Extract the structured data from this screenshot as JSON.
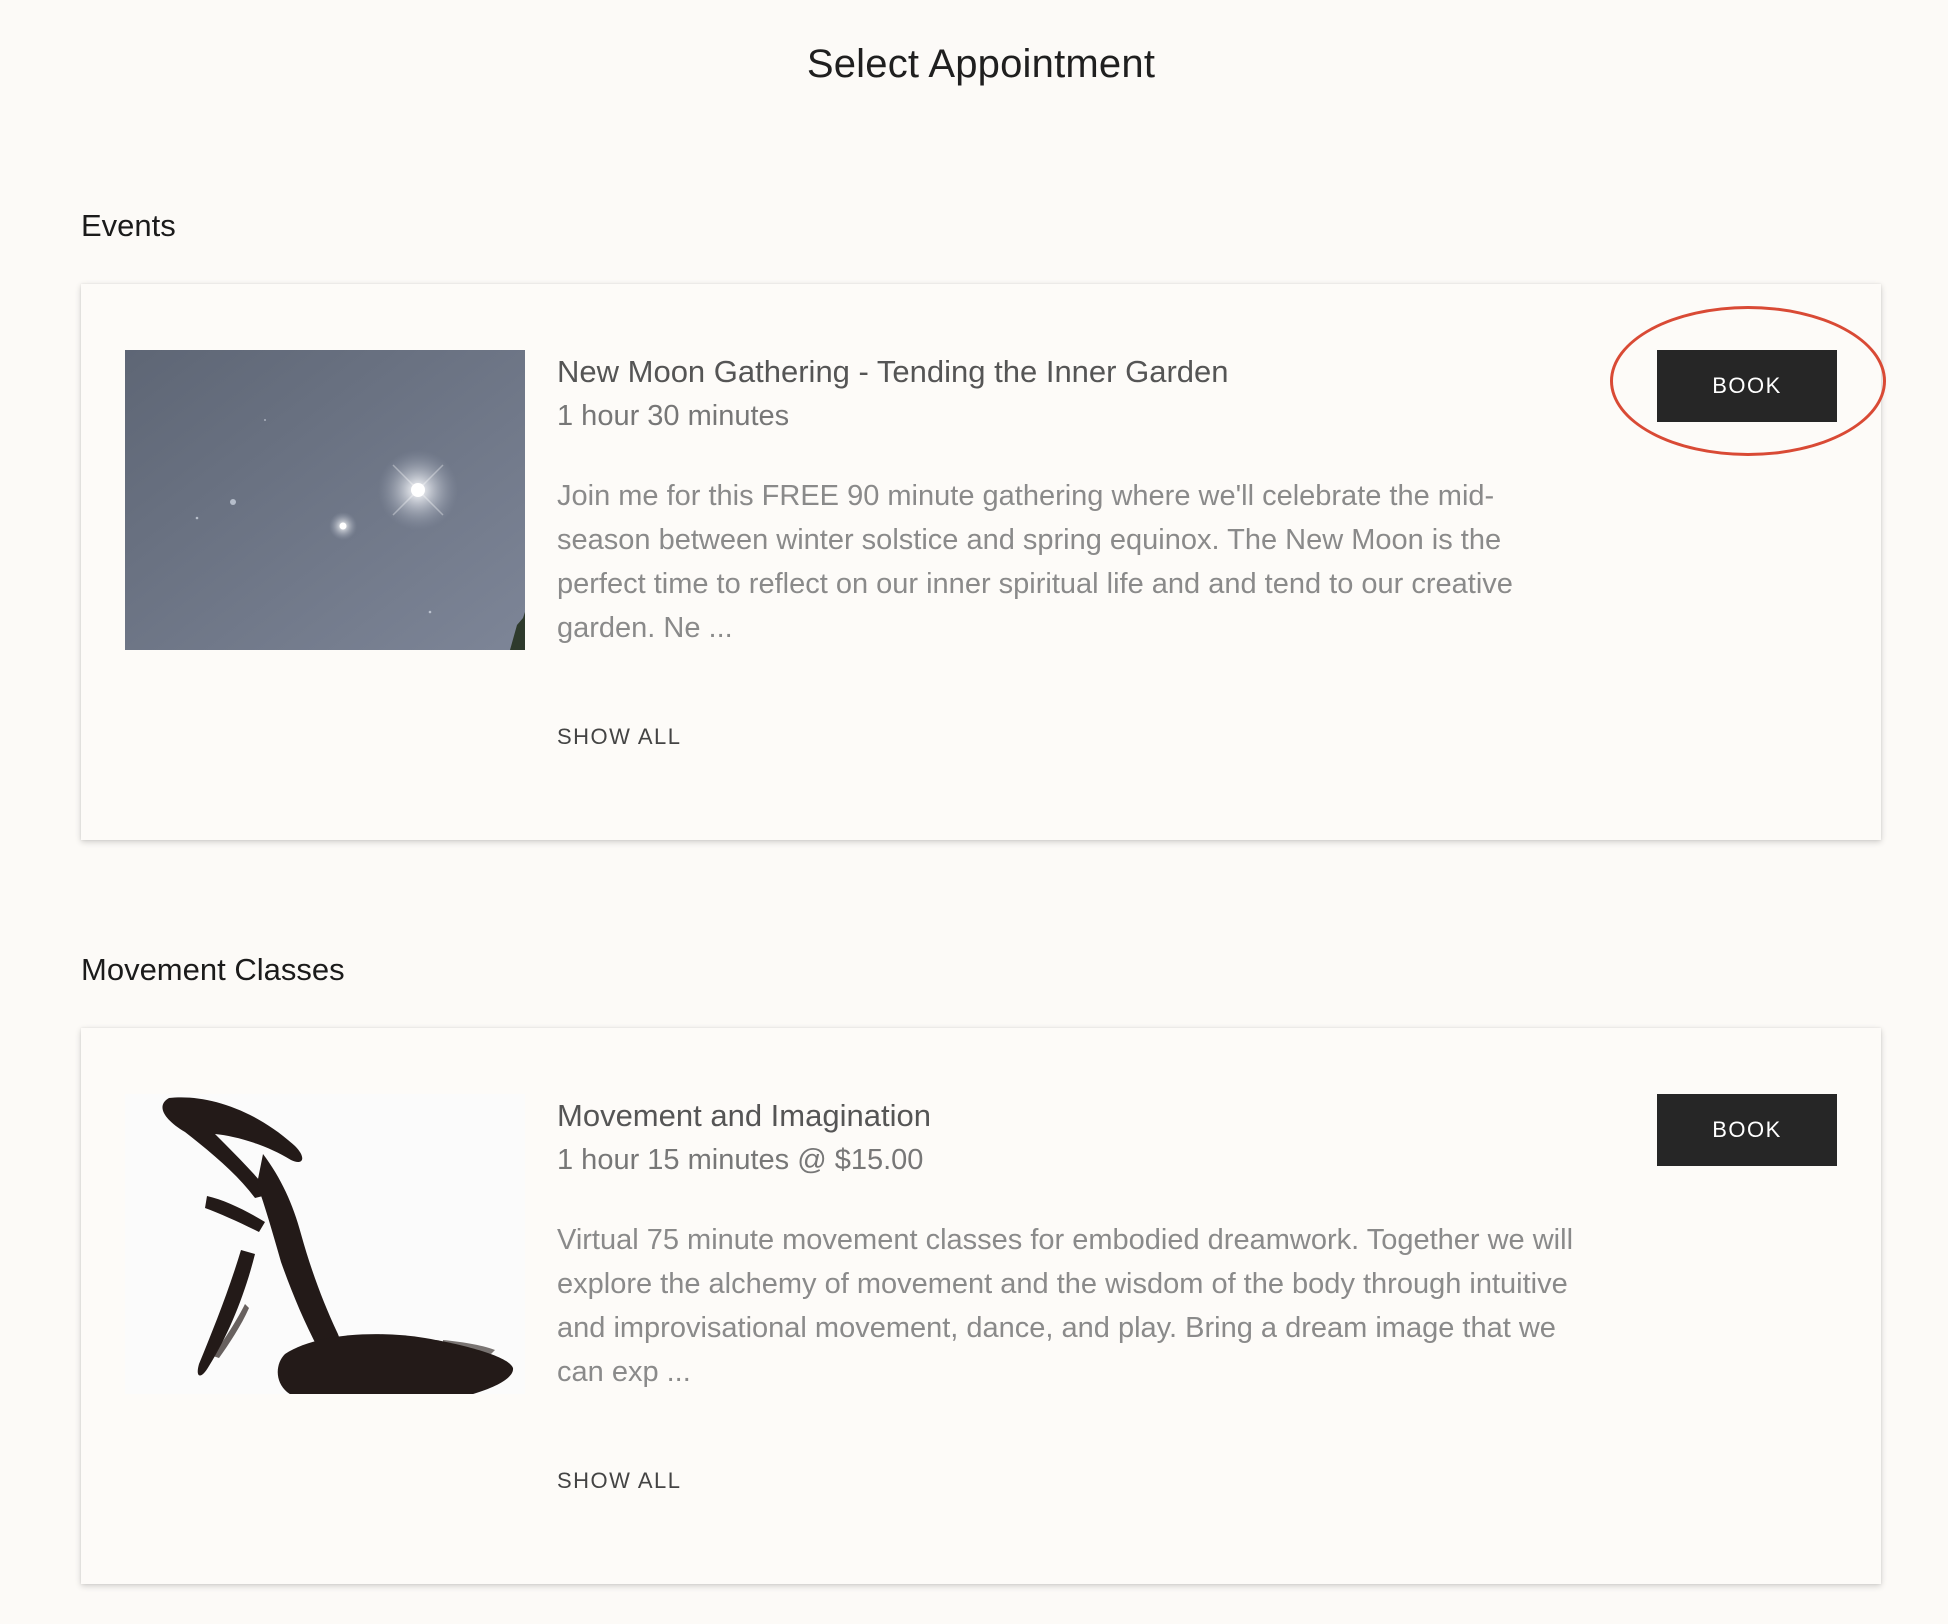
{
  "page": {
    "title": "Select Appointment"
  },
  "sections": [
    {
      "title": "Events",
      "item": {
        "title": "New Moon Gathering - Tending the Inner Garden",
        "duration": "1 hour 30 minutes",
        "description": "Join me for this FREE 90 minute gathering where we'll celebrate the mid-season between winter solstice and spring equinox. The New Moon is the perfect time to reflect on our inner spiritual life and and tend to our creative garden. Ne ...",
        "show_all_label": "SHOW ALL",
        "book_label": "BOOK",
        "image_icon": "night-sky-image"
      }
    },
    {
      "title": "Movement Classes",
      "item": {
        "title": "Movement and Imagination",
        "duration": "1 hour 15 minutes @ $15.00",
        "description": "Virtual 75 minute movement classes for embodied dreamwork. Together we will explore the alchemy of movement and the wisdom of the body through intuitive and improvisational movement, dance, and play. Bring a dream image that we can exp ...",
        "show_all_label": "SHOW ALL",
        "book_label": "BOOK",
        "image_icon": "ink-brush-figure-image"
      }
    }
  ],
  "colors": {
    "background": "#fcfaf7",
    "button": "#262626",
    "highlight": "#d94a35"
  }
}
